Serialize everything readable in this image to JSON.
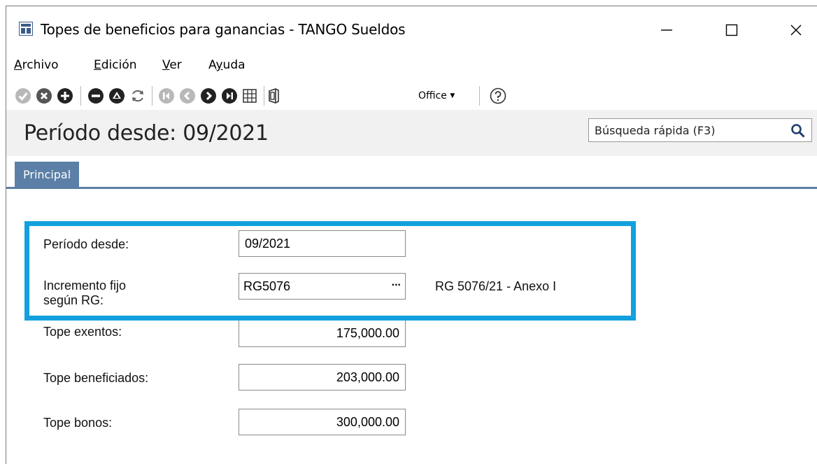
{
  "window": {
    "title": "Topes de beneficios para ganancias - TANGO Sueldos",
    "controls": {
      "minimize": "minimize-icon",
      "maximize": "maximize-icon",
      "close": "close-icon"
    }
  },
  "menu": {
    "items": [
      {
        "label": "Archivo",
        "mnemonic": "A",
        "rest": "rchivo"
      },
      {
        "label": "Edición",
        "mnemonic": "E",
        "rest": "dición"
      },
      {
        "label": "Ver",
        "mnemonic": "V",
        "rest": "er"
      },
      {
        "label": "Ayuda",
        "pre": "A",
        "mnemonic": "y",
        "rest": "uda"
      }
    ]
  },
  "toolbar": {
    "office_label": "Office",
    "icons": [
      "confirm-icon",
      "cancel-icon",
      "add-icon",
      "remove-icon",
      "clear-icon",
      "refresh-icon",
      "first-record-icon",
      "previous-record-icon",
      "next-record-icon",
      "last-record-icon",
      "grid-icon",
      "office-icon",
      "help-icon"
    ]
  },
  "header": {
    "title": "Período desde: 09/2021",
    "search_placeholder": "Búsqueda rápida (F3)"
  },
  "tabs": [
    {
      "label": "Principal",
      "active": true
    }
  ],
  "form": {
    "periodo_desde": {
      "label": "Período desde:",
      "value": "09/2021"
    },
    "incremento": {
      "label_line1": "Incremento fijo",
      "label_line2": "según RG:",
      "value": "RG5076",
      "button": "...",
      "description": "RG 5076/21 - Anexo I"
    },
    "tope_exentos": {
      "label": "Tope exentos:",
      "value": "175,000.00"
    },
    "tope_beneficiados": {
      "label": "Tope beneficiados:",
      "value": "203,000.00"
    },
    "tope_bonos": {
      "label": "Tope bonos:",
      "value": "300,000.00"
    }
  },
  "colors": {
    "accent": "#5b7fa6",
    "highlight": "#12a1dd",
    "icon": "#555555"
  }
}
